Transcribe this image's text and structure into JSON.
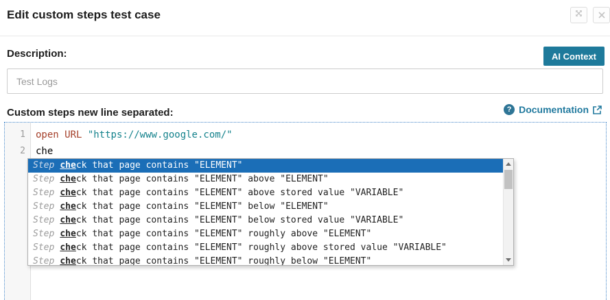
{
  "window": {
    "title": "Edit custom steps test case"
  },
  "description": {
    "label": "Description:",
    "value": "Test Logs",
    "ai_context_button": "AI Context"
  },
  "steps": {
    "label": "Custom steps new line separated:",
    "documentation": {
      "help_icon_glyph": "?",
      "label": "Documentation"
    }
  },
  "editor": {
    "lines": [
      {
        "number": "1",
        "keyword": "open URL",
        "string": "\"https://www.google.com/\""
      },
      {
        "number": "2",
        "text": "che"
      }
    ]
  },
  "autocomplete": {
    "prefix": "Step",
    "typed": "che",
    "selected_index": 0,
    "items": [
      {
        "rest": "ck that page contains \"ELEMENT\""
      },
      {
        "rest": "ck that page contains \"ELEMENT\" above \"ELEMENT\""
      },
      {
        "rest": "ck that page contains \"ELEMENT\" above stored value \"VARIABLE\""
      },
      {
        "rest": "ck that page contains \"ELEMENT\" below \"ELEMENT\""
      },
      {
        "rest": "ck that page contains \"ELEMENT\" below stored value \"VARIABLE\""
      },
      {
        "rest": "ck that page contains \"ELEMENT\" roughly above \"ELEMENT\""
      },
      {
        "rest": "ck that page contains \"ELEMENT\" roughly above stored value \"VARIABLE\""
      },
      {
        "rest": "ck that page contains \"ELEMENT\" roughly below \"ELEMENT\""
      }
    ]
  },
  "colors": {
    "ai_context_bg": "#1e7a9b",
    "documentation_link": "#20799e",
    "help_icon_bg": "#2e7596",
    "editor_focus_border": "#4285c8",
    "keyword": "#a5402a",
    "string": "#14828c",
    "hint_selected_bg": "#1b6eb7"
  }
}
